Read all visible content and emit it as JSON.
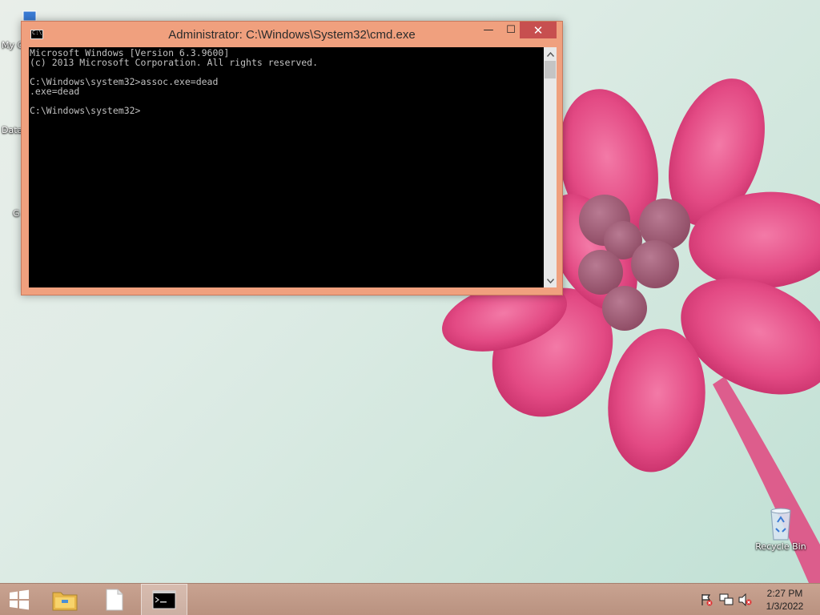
{
  "desktop": {
    "icons": [
      {
        "label": "My C",
        "icon": "computer-icon"
      },
      {
        "label": "Data",
        "icon": "database-icon"
      },
      {
        "label": "G",
        "icon": "shortcut-icon"
      }
    ],
    "recycle_bin": {
      "label": "Recycle Bin",
      "icon": "recycle-bin-icon"
    }
  },
  "cmd_window": {
    "title": "Administrator: C:\\Windows\\System32\\cmd.exe",
    "controls": {
      "minimize": "—",
      "maximize": "☐",
      "close": "✕"
    },
    "lines": [
      "Microsoft Windows [Version 6.3.9600]",
      "(c) 2013 Microsoft Corporation. All rights reserved.",
      "",
      "C:\\Windows\\system32>assoc.exe=dead",
      ".exe=dead",
      "",
      "C:\\Windows\\system32>"
    ]
  },
  "taskbar": {
    "items": [
      {
        "name": "start",
        "icon": "windows-logo-icon"
      },
      {
        "name": "file-explorer",
        "icon": "folder-icon"
      },
      {
        "name": "blank-document",
        "icon": "document-icon"
      },
      {
        "name": "command-prompt",
        "icon": "cmd-icon",
        "active": true
      }
    ],
    "tray": {
      "icons": [
        "action-center-flag-icon",
        "network-icon",
        "volume-muted-icon"
      ],
      "time": "2:27 PM",
      "date": "1/3/2022"
    }
  },
  "colors": {
    "window_frame": "#f0a07e",
    "close_button": "#c74f4f",
    "console_bg": "#000000",
    "console_text": "#c0c0c0",
    "taskbar": "#c19b89",
    "flower": "#e0457f"
  }
}
